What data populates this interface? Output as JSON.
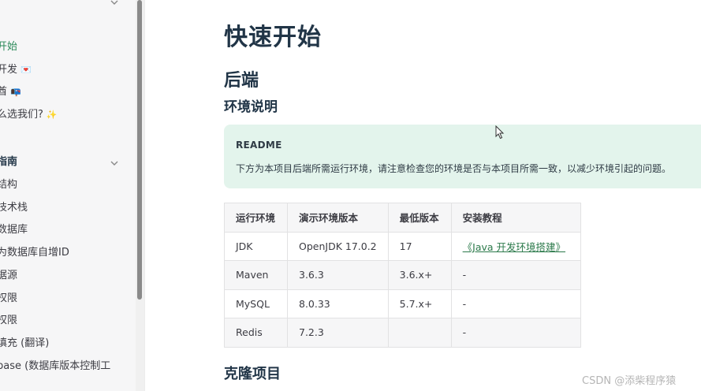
{
  "sidebar": {
    "items": [
      {
        "label": "开始",
        "emoji": "",
        "active": true
      },
      {
        "label": "开发",
        "emoji": "💌",
        "active": false
      },
      {
        "label": "酋",
        "emoji": "📭",
        "active": false
      },
      {
        "label": "么选我们?",
        "emoji": "✨",
        "active": false
      }
    ],
    "section_title": "指南",
    "section_items": [
      "结构",
      "技术栈",
      "数据库",
      "为数据库自增ID",
      "据源",
      "权限",
      "权限",
      "填充 (翻译)",
      "base (数据库版本控制工"
    ]
  },
  "main": {
    "title": "快速开始",
    "section_backend": "后端",
    "subsection_env": "环境说明",
    "tip": {
      "title": "README",
      "text": "下方为本项目后端所需运行环境，请注意检查您的环境是否与本项目所需一致，以减少环境引起的问题。"
    },
    "table": {
      "headers": [
        "运行环境",
        "演示环境版本",
        "最低版本",
        "安装教程"
      ],
      "rows": [
        [
          "JDK",
          "OpenJDK 17.0.2",
          "17",
          "《Java 开发环境搭建》"
        ],
        [
          "Maven",
          "3.6.3",
          "3.6.x+",
          "-"
        ],
        [
          "MySQL",
          "8.0.33",
          "5.7.x+",
          "-"
        ],
        [
          "Redis",
          "7.2.3",
          "",
          "-"
        ]
      ]
    },
    "subsection_clone": "克隆项目"
  },
  "watermark": "CSDN @添柴程序猿",
  "colors": {
    "accent": "#2c8a5a",
    "tip_bg": "#e3f4ec",
    "text": "#213547"
  }
}
